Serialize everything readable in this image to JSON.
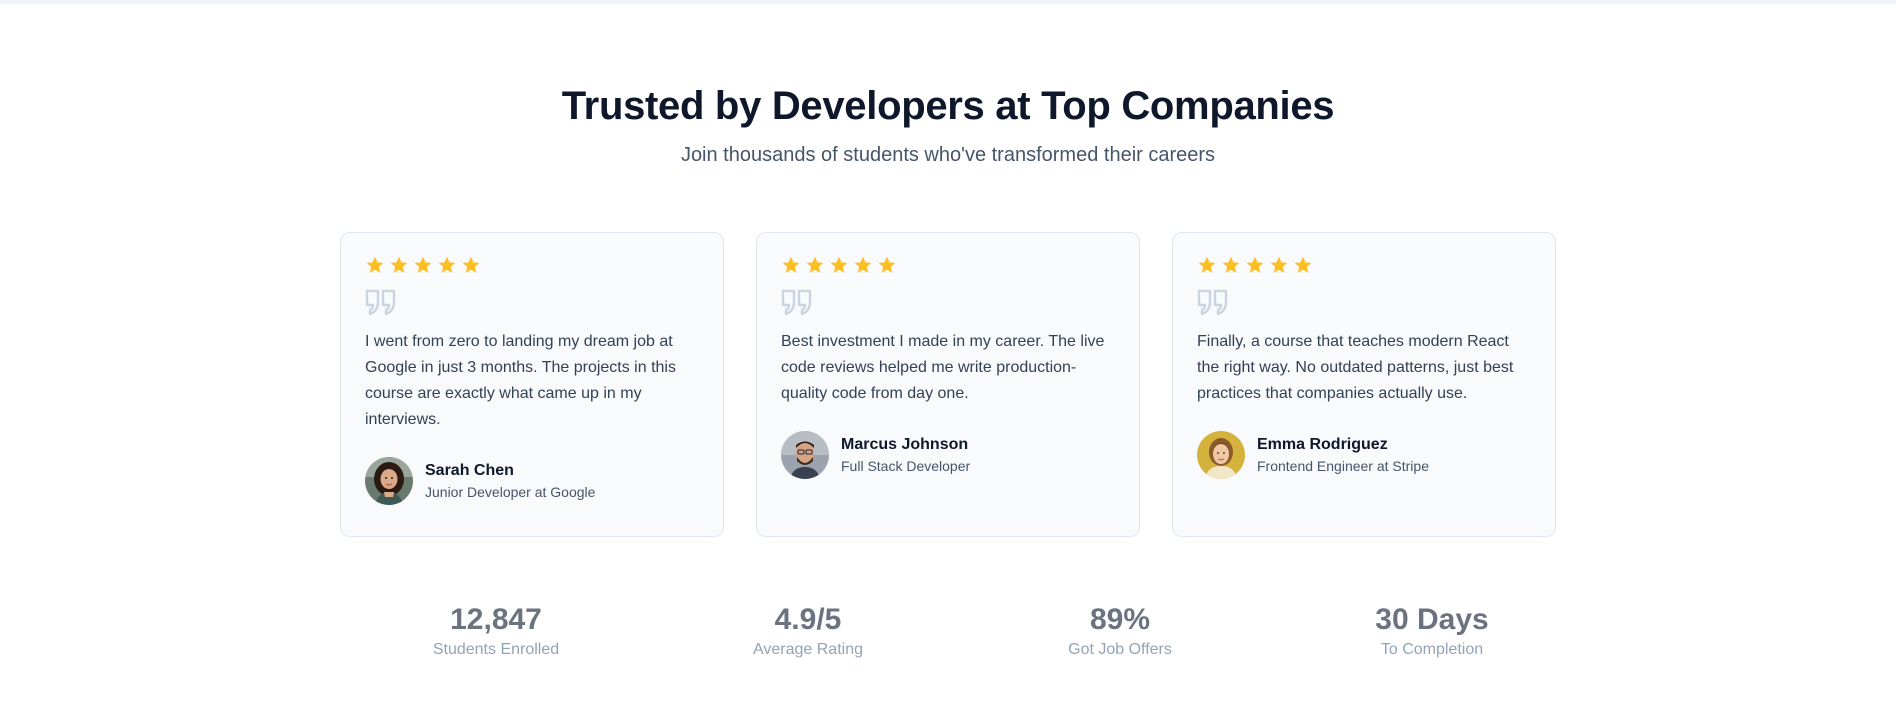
{
  "header": {
    "title": "Trusted by Developers at Top Companies",
    "subtitle": "Join thousands of students who've transformed their careers"
  },
  "colors": {
    "star": "#fbbf24",
    "quote_icon": "#cbd5e1",
    "title": "#0f172a",
    "stat_value": "#6b7280"
  },
  "testimonials": [
    {
      "rating": 5,
      "text": "I went from zero to landing my dream job at Google in just 3 months. The projects in this course are exactly what came up in my interviews.",
      "name": "Sarah Chen",
      "role": "Junior Developer at Google",
      "avatar_icon": "avatar-sarah"
    },
    {
      "rating": 5,
      "text": "Best investment I made in my career. The live code reviews helped me write production-quality code from day one.",
      "name": "Marcus Johnson",
      "role": "Full Stack Developer",
      "avatar_icon": "avatar-marcus"
    },
    {
      "rating": 5,
      "text": "Finally, a course that teaches modern React the right way. No outdated patterns, just best practices that companies actually use.",
      "name": "Emma Rodriguez",
      "role": "Frontend Engineer at Stripe",
      "avatar_icon": "avatar-emma"
    }
  ],
  "stats": [
    {
      "value": "12,847",
      "label": "Students Enrolled"
    },
    {
      "value": "4.9/5",
      "label": "Average Rating"
    },
    {
      "value": "89%",
      "label": "Got Job Offers"
    },
    {
      "value": "30 Days",
      "label": "To Completion"
    }
  ]
}
